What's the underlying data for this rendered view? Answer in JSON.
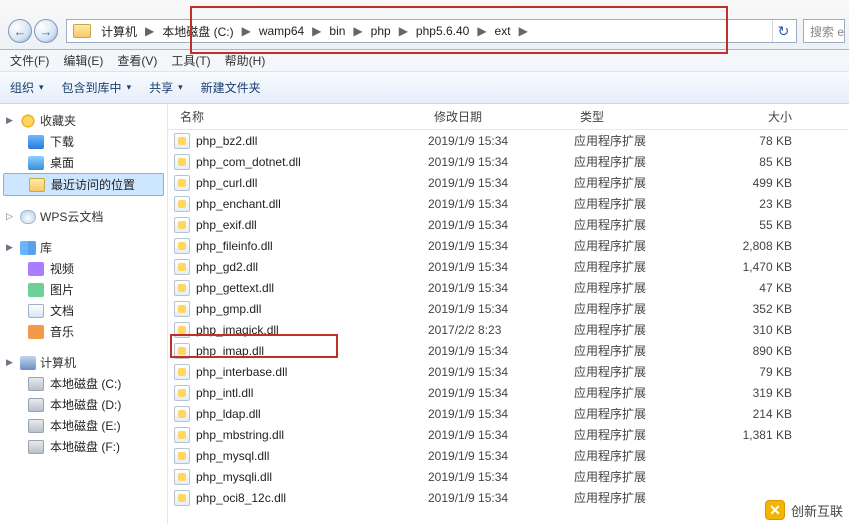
{
  "addressbar": {
    "crumbs": [
      "计算机",
      "本地磁盘 (C:)",
      "wamp64",
      "bin",
      "php",
      "php5.6.40",
      "ext"
    ],
    "search_placeholder": "搜索 e"
  },
  "menubar": {
    "file": "文件(F)",
    "edit": "编辑(E)",
    "view": "查看(V)",
    "tools": "工具(T)",
    "help": "帮助(H)"
  },
  "toolbar": {
    "organize": "组织",
    "include": "包含到库中",
    "share": "共享",
    "newfolder": "新建文件夹"
  },
  "sidebar": {
    "fav_header": "收藏夹",
    "fav_items": [
      {
        "label": "下载",
        "icon": "ic-dl"
      },
      {
        "label": "桌面",
        "icon": "ic-desk"
      },
      {
        "label": "最近访问的位置",
        "icon": "ic-recent",
        "selected": true
      }
    ],
    "wps_header": "WPS云文档",
    "lib_header": "库",
    "lib_items": [
      {
        "label": "视频",
        "icon": "ic-vid"
      },
      {
        "label": "图片",
        "icon": "ic-img"
      },
      {
        "label": "文档",
        "icon": "ic-doc"
      },
      {
        "label": "音乐",
        "icon": "ic-mus"
      }
    ],
    "pc_header": "计算机",
    "pc_items": [
      {
        "label": "本地磁盘 (C:)",
        "icon": "ic-disk"
      },
      {
        "label": "本地磁盘 (D:)",
        "icon": "ic-disk"
      },
      {
        "label": "本地磁盘 (E:)",
        "icon": "ic-disk"
      },
      {
        "label": "本地磁盘 (F:)",
        "icon": "ic-disk"
      }
    ]
  },
  "columns": {
    "name": "名称",
    "date": "修改日期",
    "type": "类型",
    "size": "大小"
  },
  "files": [
    {
      "name": "php_bz2.dll",
      "date": "2019/1/9 15:34",
      "type": "应用程序扩展",
      "size": "78 KB"
    },
    {
      "name": "php_com_dotnet.dll",
      "date": "2019/1/9 15:34",
      "type": "应用程序扩展",
      "size": "85 KB"
    },
    {
      "name": "php_curl.dll",
      "date": "2019/1/9 15:34",
      "type": "应用程序扩展",
      "size": "499 KB"
    },
    {
      "name": "php_enchant.dll",
      "date": "2019/1/9 15:34",
      "type": "应用程序扩展",
      "size": "23 KB"
    },
    {
      "name": "php_exif.dll",
      "date": "2019/1/9 15:34",
      "type": "应用程序扩展",
      "size": "55 KB"
    },
    {
      "name": "php_fileinfo.dll",
      "date": "2019/1/9 15:34",
      "type": "应用程序扩展",
      "size": "2,808 KB"
    },
    {
      "name": "php_gd2.dll",
      "date": "2019/1/9 15:34",
      "type": "应用程序扩展",
      "size": "1,470 KB"
    },
    {
      "name": "php_gettext.dll",
      "date": "2019/1/9 15:34",
      "type": "应用程序扩展",
      "size": "47 KB"
    },
    {
      "name": "php_gmp.dll",
      "date": "2019/1/9 15:34",
      "type": "应用程序扩展",
      "size": "352 KB"
    },
    {
      "name": "php_imagick.dll",
      "date": "2017/2/2 8:23",
      "type": "应用程序扩展",
      "size": "310 KB"
    },
    {
      "name": "php_imap.dll",
      "date": "2019/1/9 15:34",
      "type": "应用程序扩展",
      "size": "890 KB"
    },
    {
      "name": "php_interbase.dll",
      "date": "2019/1/9 15:34",
      "type": "应用程序扩展",
      "size": "79 KB"
    },
    {
      "name": "php_intl.dll",
      "date": "2019/1/9 15:34",
      "type": "应用程序扩展",
      "size": "319 KB"
    },
    {
      "name": "php_ldap.dll",
      "date": "2019/1/9 15:34",
      "type": "应用程序扩展",
      "size": "214 KB"
    },
    {
      "name": "php_mbstring.dll",
      "date": "2019/1/9 15:34",
      "type": "应用程序扩展",
      "size": "1,381 KB"
    },
    {
      "name": "php_mysql.dll",
      "date": "2019/1/9 15:34",
      "type": "应用程序扩展",
      "size": ""
    },
    {
      "name": "php_mysqli.dll",
      "date": "2019/1/9 15:34",
      "type": "应用程序扩展",
      "size": ""
    },
    {
      "name": "php_oci8_12c.dll",
      "date": "2019/1/9 15:34",
      "type": "应用程序扩展",
      "size": ""
    }
  ],
  "watermark": {
    "text": "创新互联"
  }
}
